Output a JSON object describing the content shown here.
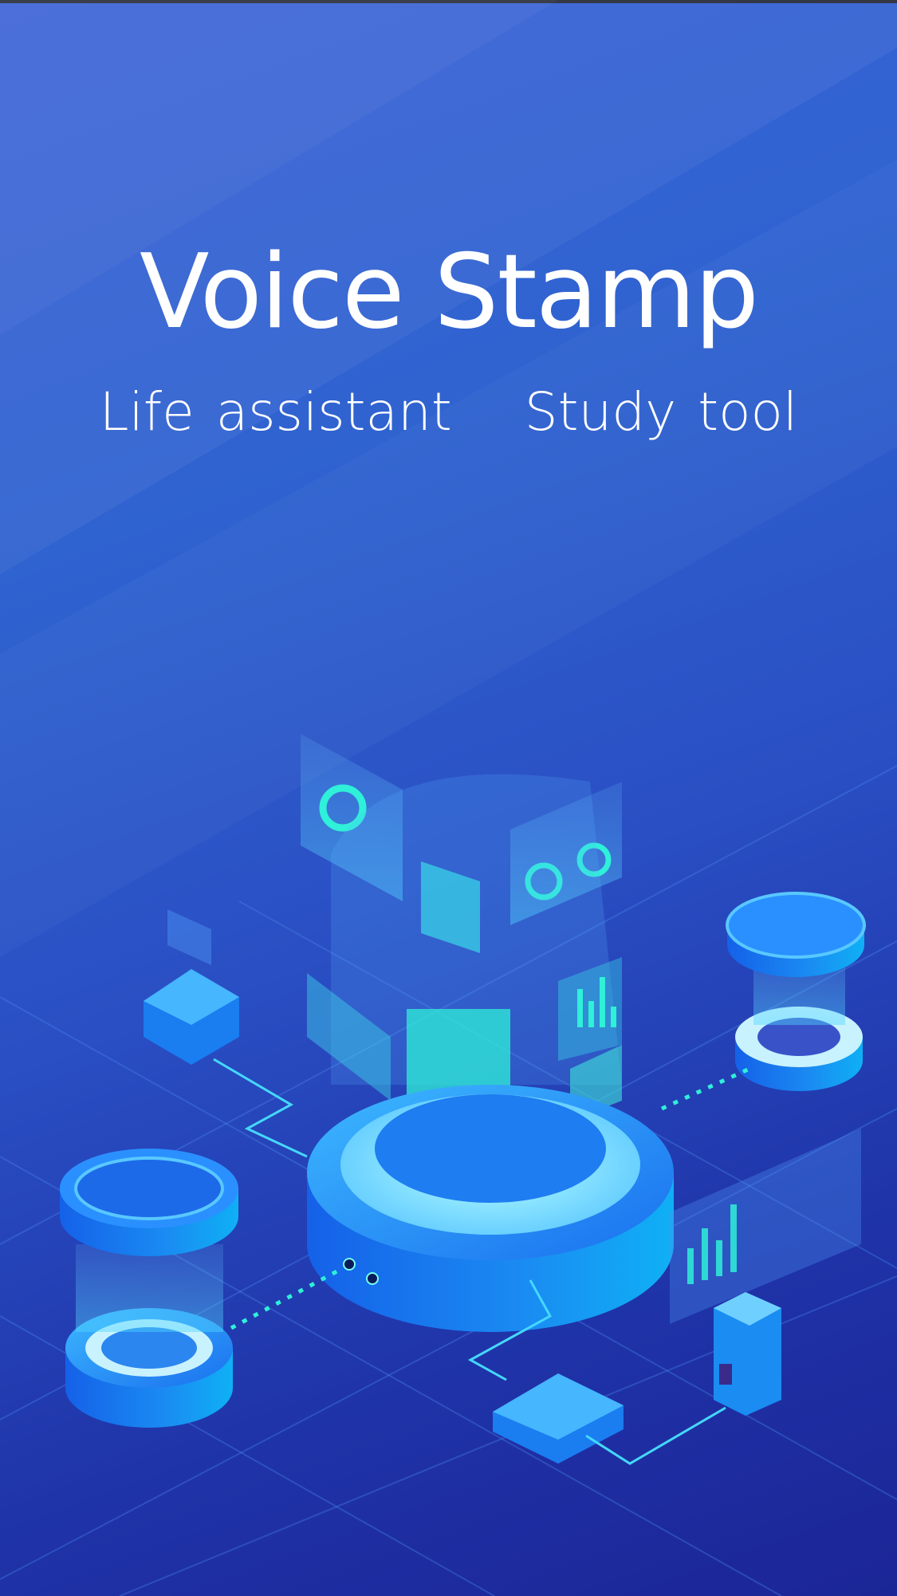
{
  "app": {
    "title": "Voice Stamp",
    "taglines": [
      "Life assistant",
      "Study tool"
    ]
  },
  "colors": {
    "background_top": "#3b63d6",
    "background_bottom": "#1b2596",
    "accent_cyan": "#2ff0d8",
    "platform_blue": "#1e8cf0"
  },
  "illustration": {
    "icon": "isometric-smart-hub-illustration"
  }
}
